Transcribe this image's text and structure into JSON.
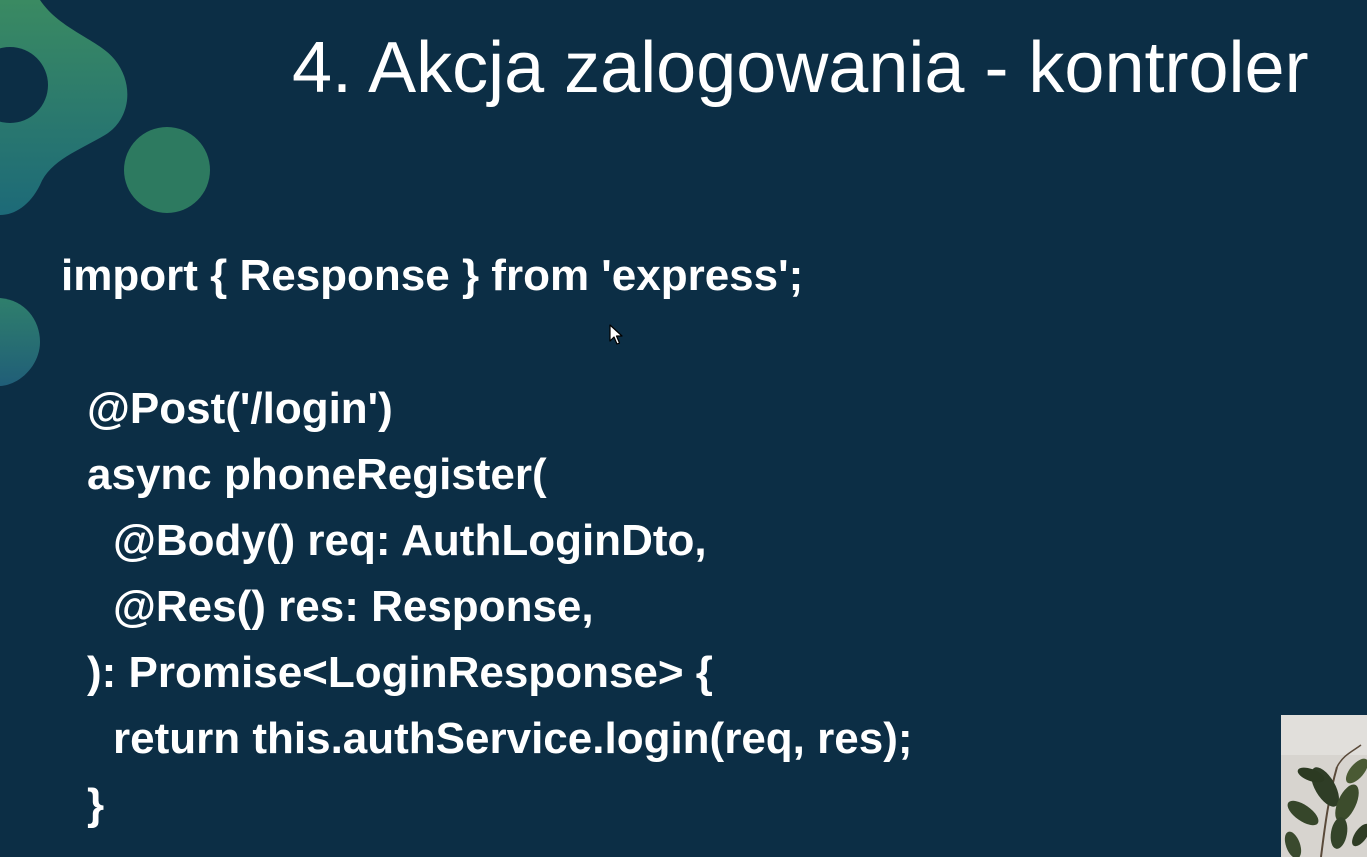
{
  "slide": {
    "title": "4. Akcja zalogowania - kontroler",
    "code_lines": [
      "import { Response } from 'express';",
      "@Post('/login')",
      "async phoneRegister(",
      "@Body() req: AuthLoginDto,",
      "@Res() res: Response,",
      "): Promise<LoginResponse> {",
      "return this.authService.login(req, res);",
      "}"
    ]
  },
  "colors": {
    "background": "#0c2e45",
    "text": "#ffffff",
    "accent_green": "#2f7a5e",
    "accent_teal": "#1f6a7e"
  },
  "icons": {
    "cursor": "mouse-pointer-icon"
  }
}
